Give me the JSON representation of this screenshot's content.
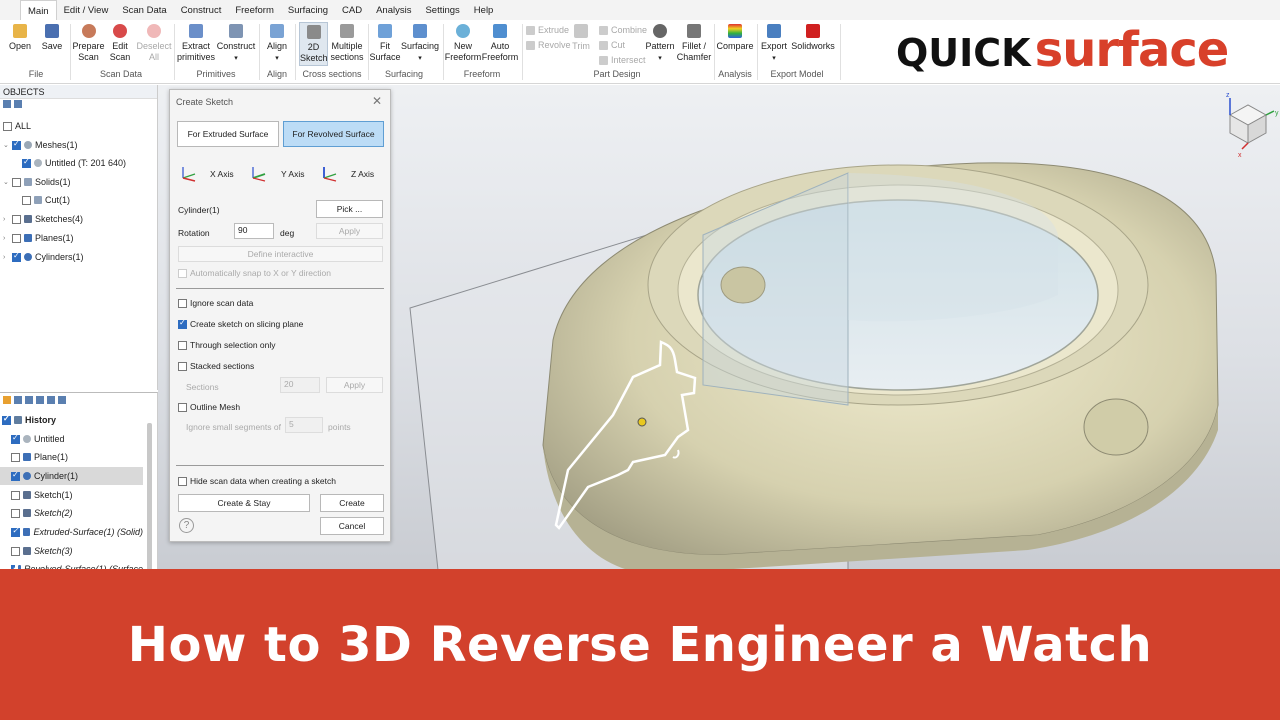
{
  "menu": {
    "items": [
      "Main",
      "Edit / View",
      "Scan Data",
      "Construct",
      "Freeform",
      "Surfacing",
      "CAD",
      "Analysis",
      "Settings",
      "Help"
    ]
  },
  "ribbon": {
    "open": "Open",
    "save": "Save",
    "file_group": "File",
    "prepare_scan": [
      "Prepare",
      "Scan"
    ],
    "edit_scan": [
      "Edit",
      "Scan"
    ],
    "deselect_all": [
      "Deselect",
      "All"
    ],
    "scan_data_group": "Scan Data",
    "extract_primitives": [
      "Extract",
      "primitives"
    ],
    "construct": "Construct",
    "primitives_group": "Primitives",
    "align": "Align",
    "align_group": "Align",
    "sketch_2d": [
      "2D",
      "Sketch"
    ],
    "multiple_sections": [
      "Multiple",
      "sections"
    ],
    "cross_sections_group": "Cross sections",
    "fit_surface": [
      "Fit",
      "Surface"
    ],
    "surfacing": "Surfacing",
    "surfacing_group": "Surfacing",
    "new_freeform": [
      "New",
      "Freeform"
    ],
    "auto_freeform": [
      "Auto",
      "Freeform"
    ],
    "freeform_group": "Freeform",
    "extrude": "Extrude",
    "revolve": "Revolve",
    "trim": "Trim",
    "combine": "Combine",
    "cut": "Cut",
    "intersect": "Intersect",
    "pattern": "Pattern",
    "fillet_chamfer": [
      "Fillet /",
      "Chamfer"
    ],
    "part_design_group": "Part Design",
    "compare": "Compare",
    "analysis_group": "Analysis",
    "export": "Export",
    "solidworks": "Solidworks",
    "export_model_group": "Export Model"
  },
  "logo": {
    "part1": "QUICK",
    "part2": "surface"
  },
  "objects": {
    "header": "OBJECTS",
    "all": "ALL",
    "items": [
      {
        "label": "Meshes(1)"
      },
      {
        "label": "Untitled (T: 201 640)"
      },
      {
        "label": "Solids(1)"
      },
      {
        "label": "Cut(1)"
      },
      {
        "label": "Sketches(4)"
      },
      {
        "label": "Planes(1)"
      },
      {
        "label": "Cylinders(1)"
      }
    ]
  },
  "history": {
    "header": "History",
    "items": [
      {
        "label": "Untitled"
      },
      {
        "label": "Plane(1)"
      },
      {
        "label": "Cylinder(1)"
      },
      {
        "label": "Sketch(1)"
      },
      {
        "label": "Sketch(2)"
      },
      {
        "label": "Extruded-Surface(1) (Solid)"
      },
      {
        "label": "Sketch(3)"
      },
      {
        "label": "Revolved-Surface(1) (Surface"
      }
    ]
  },
  "dialog": {
    "title": "Create Sketch",
    "tab_extruded": "For Extruded Surface",
    "tab_revolved": "For Revolved Surface",
    "x_axis": "X Axis",
    "y_axis": "Y Axis",
    "z_axis": "Z Axis",
    "cylinder_label": "Cylinder(1)",
    "pick": "Pick ...",
    "rotation_label": "Rotation",
    "rotation_value": "90",
    "rotation_unit": "deg",
    "apply": "Apply",
    "define_interactive": "Define interactive",
    "auto_snap": "Automatically snap to X or Y direction",
    "ignore_scan": "Ignore scan data",
    "create_on_plane": "Create sketch on slicing plane",
    "through_selection": "Through selection only",
    "stacked_sections": "Stacked sections",
    "sections_label": "Sections",
    "sections_value": "20",
    "sections_apply": "Apply",
    "outline_mesh": "Outline Mesh",
    "ignore_small": "Ignore small segments of",
    "segments_value": "5",
    "points": "points",
    "hide_scan": "Hide scan data when creating a sketch",
    "create_stay": "Create & Stay",
    "create": "Create",
    "cancel": "Cancel",
    "help": "?"
  },
  "banner": {
    "title": "How to 3D Reverse Engineer a Watch"
  },
  "colors": {
    "accent": "#d2412c",
    "selection_blue": "#2d6cc0",
    "mesh": "#d6d2b4"
  }
}
